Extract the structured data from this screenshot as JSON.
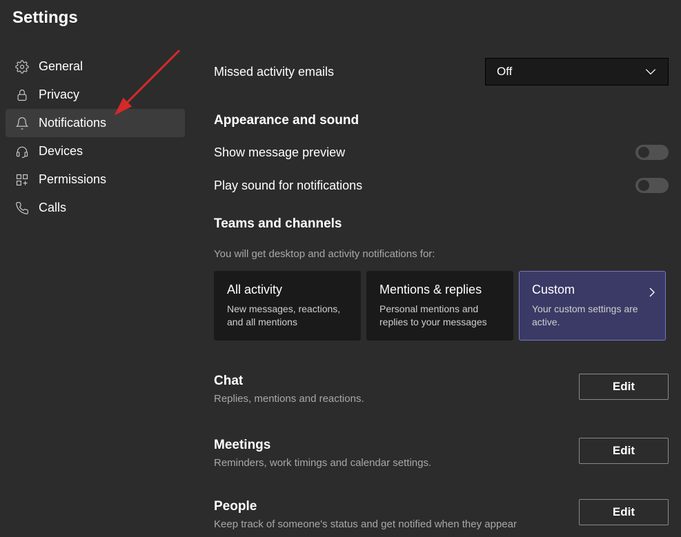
{
  "header": {
    "title": "Settings"
  },
  "sidebar": {
    "items": [
      {
        "label": "General",
        "icon": "gear-icon"
      },
      {
        "label": "Privacy",
        "icon": "lock-icon"
      },
      {
        "label": "Notifications",
        "icon": "bell-icon",
        "active": true
      },
      {
        "label": "Devices",
        "icon": "headset-icon"
      },
      {
        "label": "Permissions",
        "icon": "grid-icon"
      },
      {
        "label": "Calls",
        "icon": "phone-icon"
      }
    ]
  },
  "missed_activity": {
    "label": "Missed activity emails",
    "value": "Off"
  },
  "appearance": {
    "title": "Appearance and sound",
    "preview_label": "Show message preview",
    "sound_label": "Play sound for notifications"
  },
  "teams": {
    "title": "Teams and channels",
    "subtitle": "You will get desktop and activity notifications for:",
    "cards": [
      {
        "title": "All activity",
        "desc": "New messages, reactions, and all mentions"
      },
      {
        "title": "Mentions & replies",
        "desc": "Personal mentions and replies to your messages"
      },
      {
        "title": "Custom",
        "desc": "Your custom settings are active.",
        "selected": true
      }
    ]
  },
  "chat": {
    "title": "Chat",
    "desc": "Replies, mentions and reactions.",
    "edit": "Edit"
  },
  "meetings": {
    "title": "Meetings",
    "desc": "Reminders, work timings and calendar settings.",
    "edit": "Edit"
  },
  "people": {
    "title": "People",
    "desc": "Keep track of someone's status and get notified when they appear",
    "edit": "Edit"
  }
}
